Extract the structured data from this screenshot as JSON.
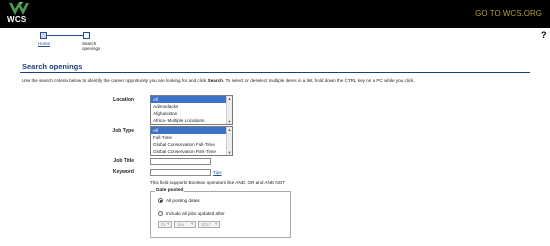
{
  "header": {
    "logo_text": "WCS",
    "goto_link": "GO TO WCS.ORG",
    "help_icon": "?"
  },
  "progress": {
    "step1": "Home",
    "step2_line1": "Search",
    "step2_line2": "openings"
  },
  "page": {
    "title": "Search openings",
    "intro_a": "Use the search criteria below to identify the career opportunity you are looking for and click ",
    "intro_bold": "Search",
    "intro_b": ".  To select or deselect multiple items in a list, hold down the CTRL key on a PC while you click."
  },
  "form": {
    "location": {
      "label": "Location",
      "options": [
        "All",
        "Adirondacks",
        "Afghanistan",
        "Africa- Multiple Locations"
      ]
    },
    "job_type": {
      "label": "Job Type",
      "options": [
        "All",
        "Full-Time",
        "Global Conservation Full-Time",
        "Global Conservation Part-Time"
      ]
    },
    "job_title": {
      "label": "Job Title",
      "value": ""
    },
    "keyword": {
      "label": "Keyword",
      "value": "",
      "tips": "Tips"
    },
    "boolean_note": "This field supports Boolean operators like AND, OR and AND NOT",
    "date_posted": {
      "legend": "Date posted",
      "opt_all": "All posting dates",
      "opt_after": "Include all jobs updated after",
      "day": "01",
      "month": "Jan",
      "year": "2017"
    }
  }
}
